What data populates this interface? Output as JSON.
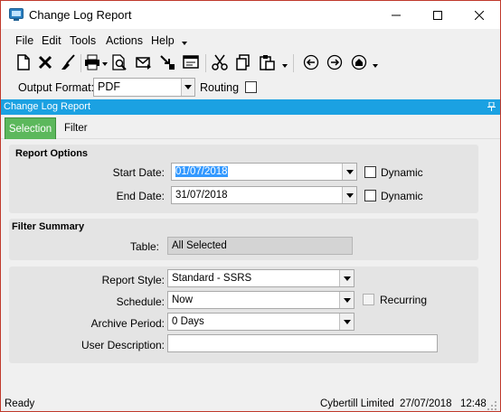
{
  "window": {
    "title": "Change Log Report"
  },
  "menu": {
    "items": [
      "File",
      "Edit",
      "Tools",
      "Actions",
      "Help"
    ]
  },
  "format_bar": {
    "output_format_label": "Output Format:",
    "output_format_value": "PDF",
    "routing_label": "Routing"
  },
  "panel": {
    "title": "Change Log Report"
  },
  "tabs": {
    "selection": "Selection",
    "filter": "Filter"
  },
  "report_options": {
    "title": "Report Options",
    "start_date_label": "Start Date:",
    "start_date_value": "01/07/2018",
    "end_date_label": "End Date:",
    "end_date_value": "31/07/2018",
    "dynamic_label": "Dynamic"
  },
  "filter_summary": {
    "title": "Filter Summary",
    "table_label": "Table:",
    "table_value": "All Selected"
  },
  "report_settings": {
    "report_style_label": "Report Style:",
    "report_style_value": "Standard - SSRS",
    "schedule_label": "Schedule:",
    "schedule_value": "Now",
    "recurring_label": "Recurring",
    "archive_label": "Archive Period:",
    "archive_value": "0 Days",
    "user_description_label": "User Description:",
    "user_description_value": ""
  },
  "status": {
    "state": "Ready",
    "company": "Cybertill Limited",
    "date": "27/07/2018",
    "time": "12:48"
  },
  "colors": {
    "accent": "#1ba1e2",
    "tab_selected": "#5cb85c",
    "window_border": "#c0392b"
  }
}
